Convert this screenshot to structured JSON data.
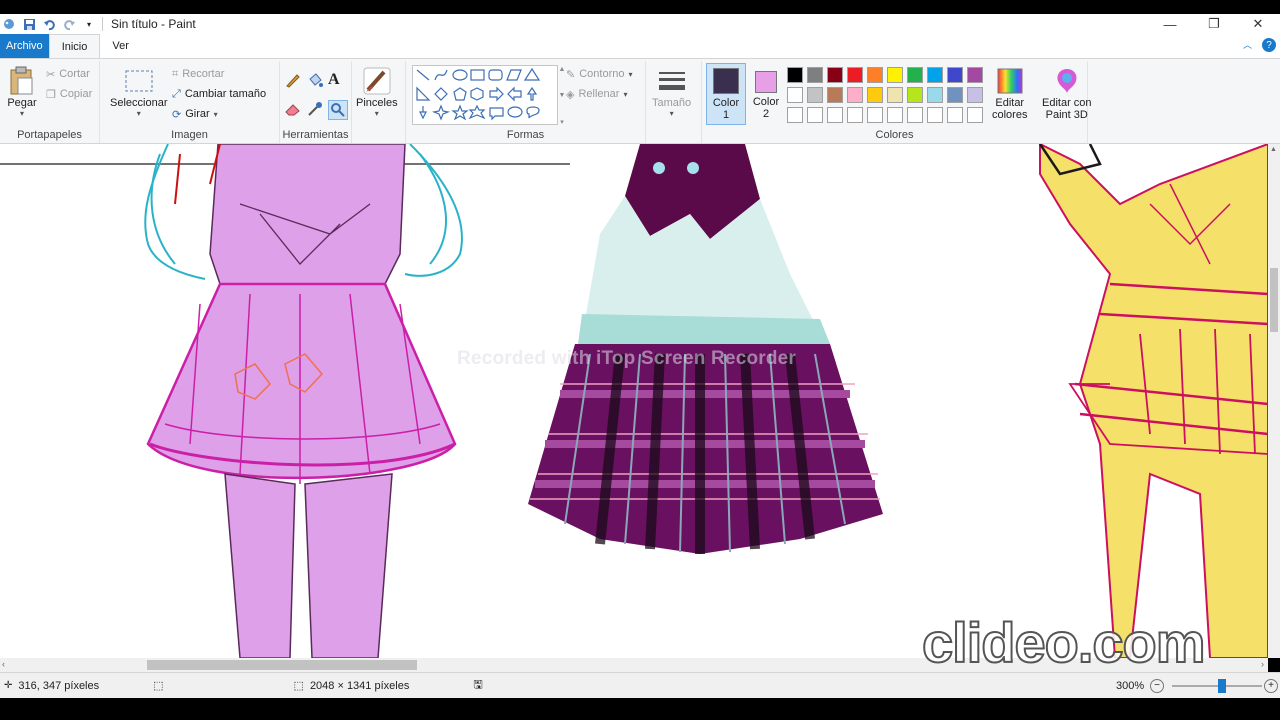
{
  "window": {
    "title": "Sin título - Paint",
    "controls": {
      "minimize": "—",
      "maximize": "❐",
      "close": "✕"
    }
  },
  "tabs": [
    {
      "label": "Archivo"
    },
    {
      "label": "Inicio"
    },
    {
      "label": "Ver"
    }
  ],
  "ribbon": {
    "clipboard": {
      "group_label": "Portapapeles",
      "paste": "Pegar",
      "cut": "Cortar",
      "copy": "Copiar"
    },
    "image": {
      "group_label": "Imagen",
      "select": "Seleccionar",
      "crop": "Recortar",
      "resize": "Cambiar tamaño",
      "rotate": "Girar"
    },
    "tools": {
      "group_label": "Herramientas"
    },
    "brushes": {
      "label": "Pinceles"
    },
    "shapes": {
      "group_label": "Formas",
      "outline": "Contorno",
      "fill": "Rellenar"
    },
    "size": {
      "label": "Tamaño"
    },
    "colors": {
      "group_label": "Colores",
      "color1_label": "Color",
      "color1_num": "1",
      "color2_label": "Color",
      "color2_num": "2",
      "color1_value": "#3a2f4f",
      "color2_value": "#e7a0e7",
      "edit_colors_l1": "Editar",
      "edit_colors_l2": "colores",
      "paint3d_l1": "Editar con",
      "paint3d_l2": "Paint 3D",
      "palette_row1": [
        "#000000",
        "#7f7f7f",
        "#880015",
        "#ed1c24",
        "#ff7f27",
        "#fff200",
        "#22b14c",
        "#00a2e8",
        "#3f48cc",
        "#a349a4"
      ],
      "palette_row2": [
        "#ffffff",
        "#c3c3c3",
        "#b97a57",
        "#ffaec9",
        "#ffc90e",
        "#efe4b0",
        "#b5e61d",
        "#99d9ea",
        "#7092be",
        "#c8bfe7"
      ]
    }
  },
  "status": {
    "cursor_pos": "316, 347 píxeles",
    "image_size": "2048 × 1341 píxeles",
    "zoom": "300%"
  },
  "watermarks": {
    "recorder": "Recorded with iTop Screen Recorder",
    "clideo": "clideo.com"
  }
}
